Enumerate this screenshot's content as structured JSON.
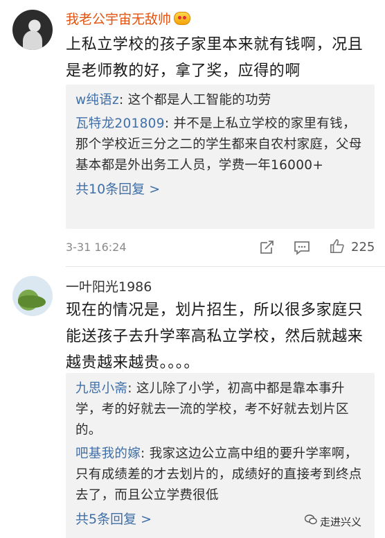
{
  "comments": [
    {
      "username": "我老公宇宙无敌帅",
      "text": "上私立学校的孩子家里本来就有钱啊，况且是老师教的好，拿了奖，应得的啊",
      "replies": [
        {
          "author": "w纯语z",
          "content": "这个都是人工智能的功劳"
        },
        {
          "author": "瓦特龙201809",
          "content": "并不是上私立学校的家里有钱，那个学校近三分之二的学生都来自农村家庭，父母基本都是外出务工人员，学费一年16000+"
        }
      ],
      "more_replies": "共10条回复 >",
      "timestamp": "3-31 16:24",
      "likes": "225"
    },
    {
      "username": "一叶阳光1986",
      "text": "现在的情况是，划片招生，所以很多家庭只能送孩子去升学率高私立学校，然后就越来越贵越来越贵。。。。",
      "replies": [
        {
          "author": "九思小斋",
          "content": "这儿除了小学，初高中都是靠本事升学，考的好就去一流的学校，考不好就去划片区的。"
        },
        {
          "author": "吧基我的嫁",
          "content": "我家这边公立高中组的要升学率啊，只有成绩差的才去划片的，成绩好的直接考到终点去了，而且公立学费很低"
        }
      ],
      "more_replies": "共5条回复 >"
    }
  ],
  "watermark": "走进兴义"
}
